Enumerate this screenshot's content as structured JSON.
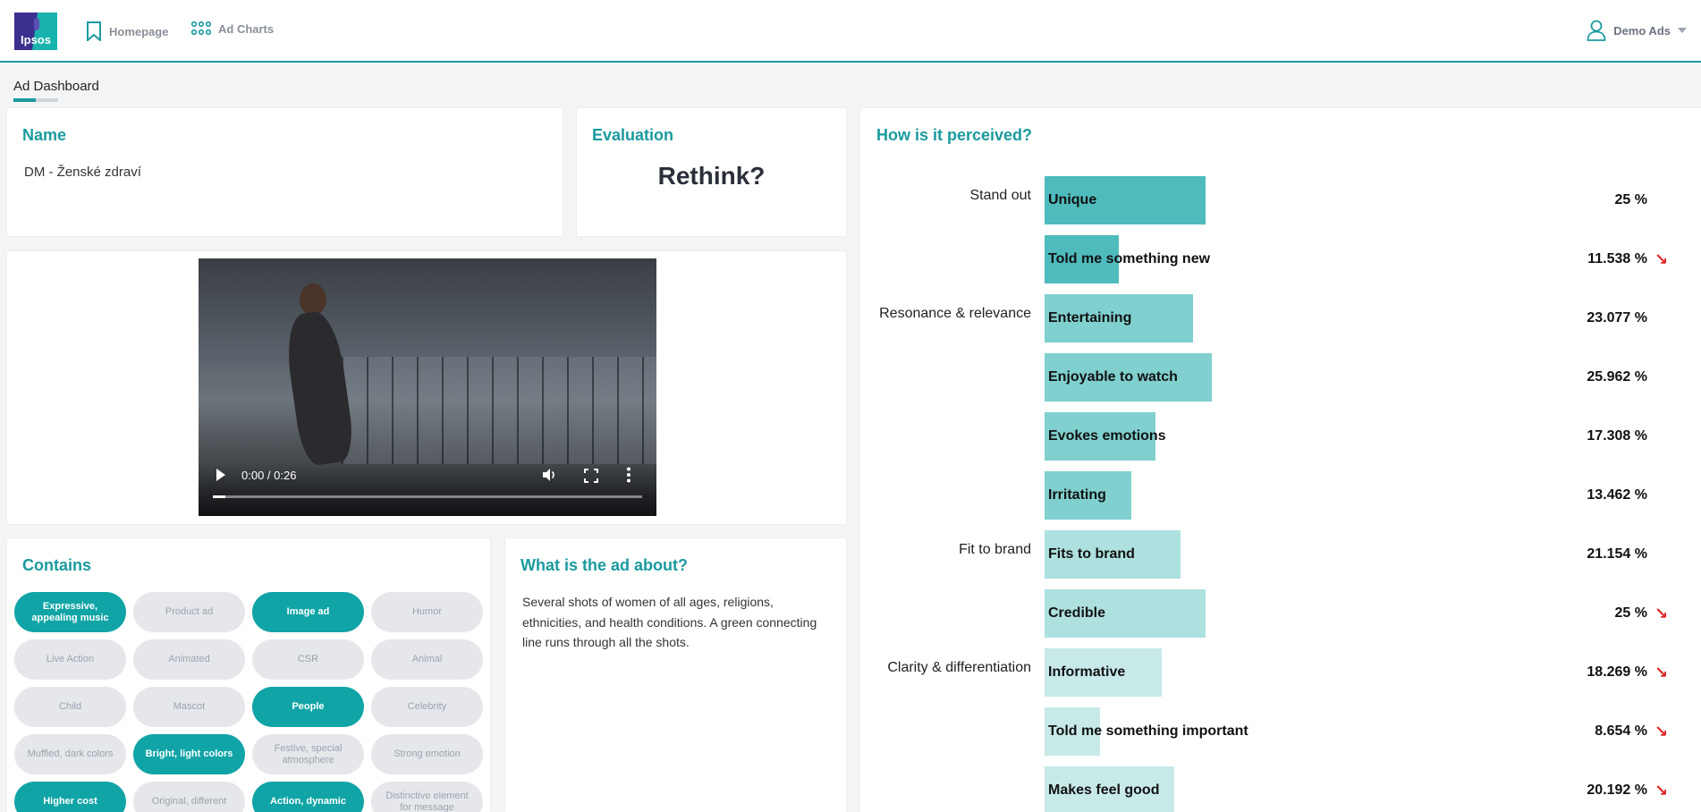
{
  "nav": {
    "logo_text": "Ipsos",
    "homepage": "Homepage",
    "ad_charts": "Ad Charts",
    "user": "Demo Ads"
  },
  "tab": {
    "label": "Ad Dashboard"
  },
  "name_card": {
    "title": "Name",
    "value": "DM - Ženské zdraví"
  },
  "evaluation_card": {
    "title": "Evaluation",
    "value": "Rethink?"
  },
  "video": {
    "time": "0:00 / 0:26",
    "progress": 0.0
  },
  "contains": {
    "title": "Contains",
    "items": [
      {
        "label": "Expressive, appealing music",
        "active": true
      },
      {
        "label": "Product ad",
        "active": false
      },
      {
        "label": "Image ad",
        "active": true
      },
      {
        "label": "Humor",
        "active": false
      },
      {
        "label": "Live Action",
        "active": false
      },
      {
        "label": "Animated",
        "active": false
      },
      {
        "label": "CSR",
        "active": false
      },
      {
        "label": "Animal",
        "active": false
      },
      {
        "label": "Child",
        "active": false
      },
      {
        "label": "Mascot",
        "active": false
      },
      {
        "label": "People",
        "active": true
      },
      {
        "label": "Celebrity",
        "active": false
      },
      {
        "label": "Muffled, dark colors",
        "active": false
      },
      {
        "label": "Bright, light colors",
        "active": true
      },
      {
        "label": "Festive, special atmosphere",
        "active": false
      },
      {
        "label": "Strong emotion",
        "active": false
      },
      {
        "label": "Higher cost",
        "active": true
      },
      {
        "label": "Original, different",
        "active": false
      },
      {
        "label": "Action, dynamic",
        "active": true
      },
      {
        "label": "Distinctive element for message",
        "active": false
      }
    ]
  },
  "about": {
    "title": "What is the ad about?",
    "text": "Several shots of women of all ages, religions, ethnicities, and health conditions. A green connecting line runs through all the shots."
  },
  "perceived": {
    "title": "How is it perceived?",
    "colors": {
      "stand_out": "#4fbbbd",
      "resonance": "#7fd0cf",
      "fit": "#ade0df",
      "clarity": "#c7eae9"
    }
  },
  "chart_data": {
    "type": "bar",
    "title": "How is it perceived?",
    "orientation": "horizontal",
    "xlim": [
      0,
      100
    ],
    "unit": "%",
    "rows": [
      {
        "group": "Stand out",
        "label": "Unique",
        "value": 25,
        "display": "25 %",
        "down": false,
        "color": "#4fbbbd"
      },
      {
        "group": "",
        "label": "Told me something new",
        "value": 11.538,
        "display": "11.538 %",
        "down": true,
        "color": "#4fbbbd"
      },
      {
        "group": "Resonance & relevance",
        "label": "Entertaining",
        "value": 23.077,
        "display": "23.077 %",
        "down": false,
        "color": "#7fd0cf"
      },
      {
        "group": "",
        "label": "Enjoyable to watch",
        "value": 25.962,
        "display": "25.962 %",
        "down": false,
        "color": "#7fd0cf"
      },
      {
        "group": "",
        "label": "Evokes emotions",
        "value": 17.308,
        "display": "17.308 %",
        "down": false,
        "color": "#7fd0cf"
      },
      {
        "group": "",
        "label": "Irritating",
        "value": 13.462,
        "display": "13.462 %",
        "down": false,
        "color": "#7fd0cf"
      },
      {
        "group": "Fit to brand",
        "label": "Fits to brand",
        "value": 21.154,
        "display": "21.154 %",
        "down": false,
        "color": "#ade0df"
      },
      {
        "group": "",
        "label": "Credible",
        "value": 25,
        "display": "25 %",
        "down": true,
        "color": "#ade0df"
      },
      {
        "group": "Clarity & differentiation",
        "label": "Informative",
        "value": 18.269,
        "display": "18.269 %",
        "down": true,
        "color": "#c7eae9"
      },
      {
        "group": "",
        "label": "Told me something important",
        "value": 8.654,
        "display": "8.654 %",
        "down": true,
        "color": "#c7eae9"
      },
      {
        "group": "",
        "label": "Makes feel good",
        "value": 20.192,
        "display": "20.192 %",
        "down": true,
        "color": "#c7eae9"
      }
    ]
  }
}
